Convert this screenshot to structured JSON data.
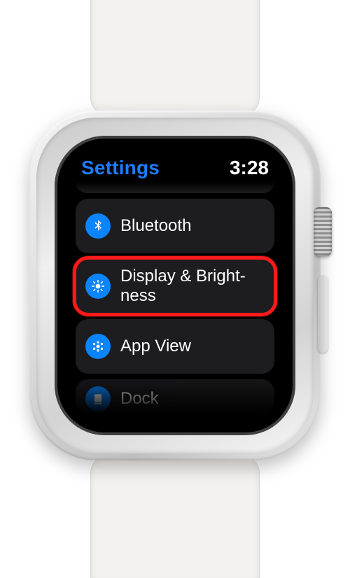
{
  "colors": {
    "accent_blue": "#0a84ff",
    "icon_bg": "#0a84ff"
  },
  "header": {
    "title": "Settings",
    "time": "3:28"
  },
  "rows": {
    "bluetooth": {
      "label": "Bluetooth"
    },
    "display": {
      "label": "Display & Bright­ness"
    },
    "appview": {
      "label": "App View"
    },
    "dock": {
      "label": "Dock"
    }
  },
  "highlighted_row": "display"
}
